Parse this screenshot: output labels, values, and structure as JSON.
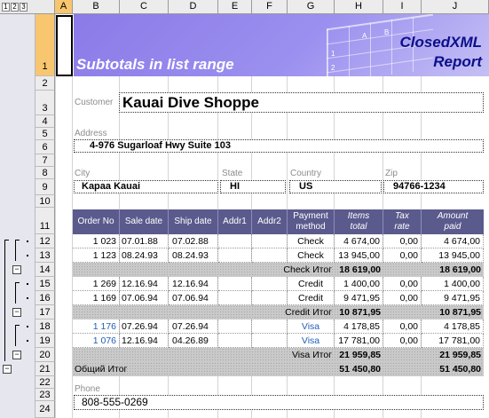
{
  "outline_levels": [
    "1",
    "2",
    "3"
  ],
  "columns": [
    "A",
    "B",
    "C",
    "D",
    "E",
    "F",
    "G",
    "H",
    "I",
    "J"
  ],
  "selected_column": "A",
  "rows": [
    "1",
    "2",
    "3",
    "4",
    "5",
    "6",
    "7",
    "8",
    "9",
    "10",
    "11",
    "12",
    "13",
    "14",
    "15",
    "16",
    "17",
    "18",
    "19",
    "20",
    "21",
    "22",
    "23",
    "24"
  ],
  "selected_row": "1",
  "banner": {
    "title": "Subtotals in list range",
    "brand1": "ClosedXML",
    "brand2": "Report",
    "grid_nums": [
      "1",
      "2"
    ],
    "grid_letters": [
      "A",
      "B"
    ]
  },
  "customer": {
    "label": "Customer",
    "value": "Kauai Dive Shoppe"
  },
  "address": {
    "label": "Address",
    "value": "4-976 Sugarloaf Hwy Suite 103"
  },
  "city": {
    "label": "City",
    "value": "Kapaa Kauai"
  },
  "state": {
    "label": "State",
    "value": "HI"
  },
  "country": {
    "label": "Country",
    "value": "US"
  },
  "zip": {
    "label": "Zip",
    "value": "94766-1234"
  },
  "phone": {
    "label": "Phone",
    "value": "808-555-0269"
  },
  "table_headers": [
    "Order No",
    "Sale date",
    "Ship date",
    "Addr1",
    "Addr2",
    "Payment method",
    "Items total",
    "Tax rate",
    "Amount paid"
  ],
  "table_rows": [
    {
      "order": "1 023",
      "sale": "07.01.88",
      "ship": "07.02.88",
      "method": "Check",
      "items": "4 674,00",
      "tax": "0,00",
      "amount": "4 674,00"
    },
    {
      "order": "1 123",
      "sale": "08.24.93",
      "ship": "08.24.93",
      "method": "Check",
      "items": "13 945,00",
      "tax": "0,00",
      "amount": "13 945,00"
    },
    {
      "subtotal": "Check Итог",
      "items": "18 619,00",
      "amount": "18 619,00"
    },
    {
      "order": "1 269",
      "sale": "12.16.94",
      "ship": "12.16.94",
      "method": "Credit",
      "items": "1 400,00",
      "tax": "0,00",
      "amount": "1 400,00"
    },
    {
      "order": "1 169",
      "sale": "07.06.94",
      "ship": "07.06.94",
      "method": "Credit",
      "items": "9 471,95",
      "tax": "0,00",
      "amount": "9 471,95"
    },
    {
      "subtotal": "Credit Итог",
      "items": "10 871,95",
      "amount": "10 871,95"
    },
    {
      "order": "1 176",
      "sale": "07.26.94",
      "ship": "07.26.94",
      "method": "Visa",
      "items": "4 178,85",
      "tax": "0,00",
      "amount": "4 178,85",
      "link": true
    },
    {
      "order": "1 076",
      "sale": "12.16.94",
      "ship": "04.26.89",
      "method": "Visa",
      "items": "17 781,00",
      "tax": "0,00",
      "amount": "17 781,00",
      "link": true
    },
    {
      "subtotal": "Visa Итог",
      "items": "21 959,85",
      "amount": "21 959,85"
    }
  ],
  "grand_total": {
    "label": "Общий Итог",
    "items": "51 450,80",
    "amount": "51 450,80"
  },
  "collapse_symbol": "−"
}
